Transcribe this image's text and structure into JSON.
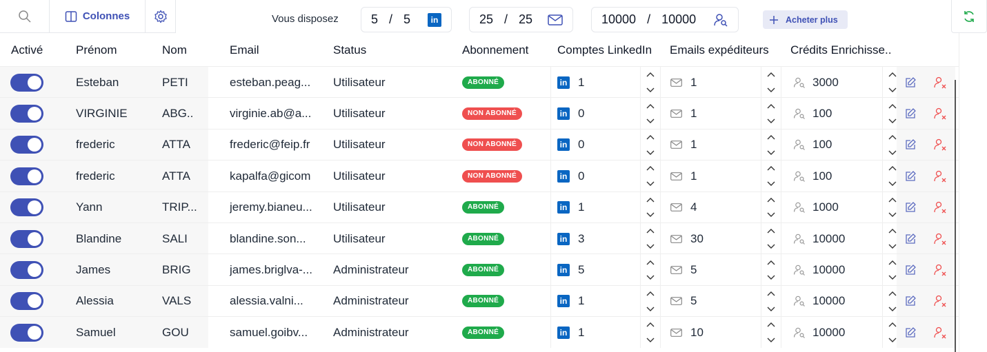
{
  "toolbar": {
    "search_icon": "search-icon",
    "columns_label": "Colonnes",
    "dispose_label": "Vous disposez",
    "linkedin": {
      "used": "5",
      "sep": "/",
      "total": "5"
    },
    "emails": {
      "used": "25",
      "sep": "/",
      "total": "25"
    },
    "credits": {
      "used": "10000",
      "sep": "/",
      "total": "10000"
    },
    "buy_label": "Acheter plus"
  },
  "columns": [
    "Activé",
    "Prénom",
    "Nom",
    "Email",
    "Status",
    "Abonnement",
    "Comptes LinkedIn",
    "Emails expéditeurs",
    "Crédits Enrichisse.."
  ],
  "colors": {
    "accent": "#3f51b5",
    "subscribed": "#1faa4b",
    "not_subscribed": "#ef4f4f",
    "linkedin": "#0a66c2"
  },
  "rows": [
    {
      "active": true,
      "prenom": "Esteban",
      "nom": "PETI",
      "email": "esteban.peag...",
      "status": "Utilisateur",
      "abonnement": "ABONNÉ",
      "subscribed": true,
      "linkedin": "1",
      "emails": "1",
      "credits": "3000"
    },
    {
      "active": true,
      "prenom": "VIRGINIE",
      "nom": "ABG..",
      "email": "virginie.ab@a...",
      "status": "Utilisateur",
      "abonnement": "NON ABONNÉ",
      "subscribed": false,
      "linkedin": "0",
      "emails": "1",
      "credits": "100"
    },
    {
      "active": true,
      "prenom": "frederic",
      "nom": "ATTA",
      "email": "frederic@feip.fr",
      "status": "Utilisateur",
      "abonnement": "NON ABONNÉ",
      "subscribed": false,
      "linkedin": "0",
      "emails": "1",
      "credits": "100"
    },
    {
      "active": true,
      "prenom": "frederic",
      "nom": "ATTA",
      "email": "kapalfa@gicom",
      "status": "Utilisateur",
      "abonnement": "NON ABONNÉ",
      "subscribed": false,
      "linkedin": "0",
      "emails": "1",
      "credits": "100"
    },
    {
      "active": true,
      "prenom": "Yann",
      "nom": "TRIP...",
      "email": "jeremy.bianeu...",
      "status": "Utilisateur",
      "abonnement": "ABONNÉ",
      "subscribed": true,
      "linkedin": "1",
      "emails": "4",
      "credits": "1000"
    },
    {
      "active": true,
      "prenom": "Blandine",
      "nom": "SALI",
      "email": "blandine.son...",
      "status": "Utilisateur",
      "abonnement": "ABONNÉ",
      "subscribed": true,
      "linkedin": "3",
      "emails": "30",
      "credits": "10000"
    },
    {
      "active": true,
      "prenom": "James",
      "nom": "BRIG",
      "email": "james.briglva-...",
      "status": "Administrateur",
      "abonnement": "ABONNÉ",
      "subscribed": true,
      "linkedin": "5",
      "emails": "5",
      "credits": "10000"
    },
    {
      "active": true,
      "prenom": "Alessia",
      "nom": "VALS",
      "email": "alessia.valni...",
      "status": "Administrateur",
      "abonnement": "ABONNÉ",
      "subscribed": true,
      "linkedin": "1",
      "emails": "5",
      "credits": "10000"
    },
    {
      "active": true,
      "prenom": "Samuel",
      "nom": "GOU",
      "email": "samuel.goibv...",
      "status": "Administrateur",
      "abonnement": "ABONNÉ",
      "subscribed": true,
      "linkedin": "1",
      "emails": "10",
      "credits": "10000"
    }
  ]
}
